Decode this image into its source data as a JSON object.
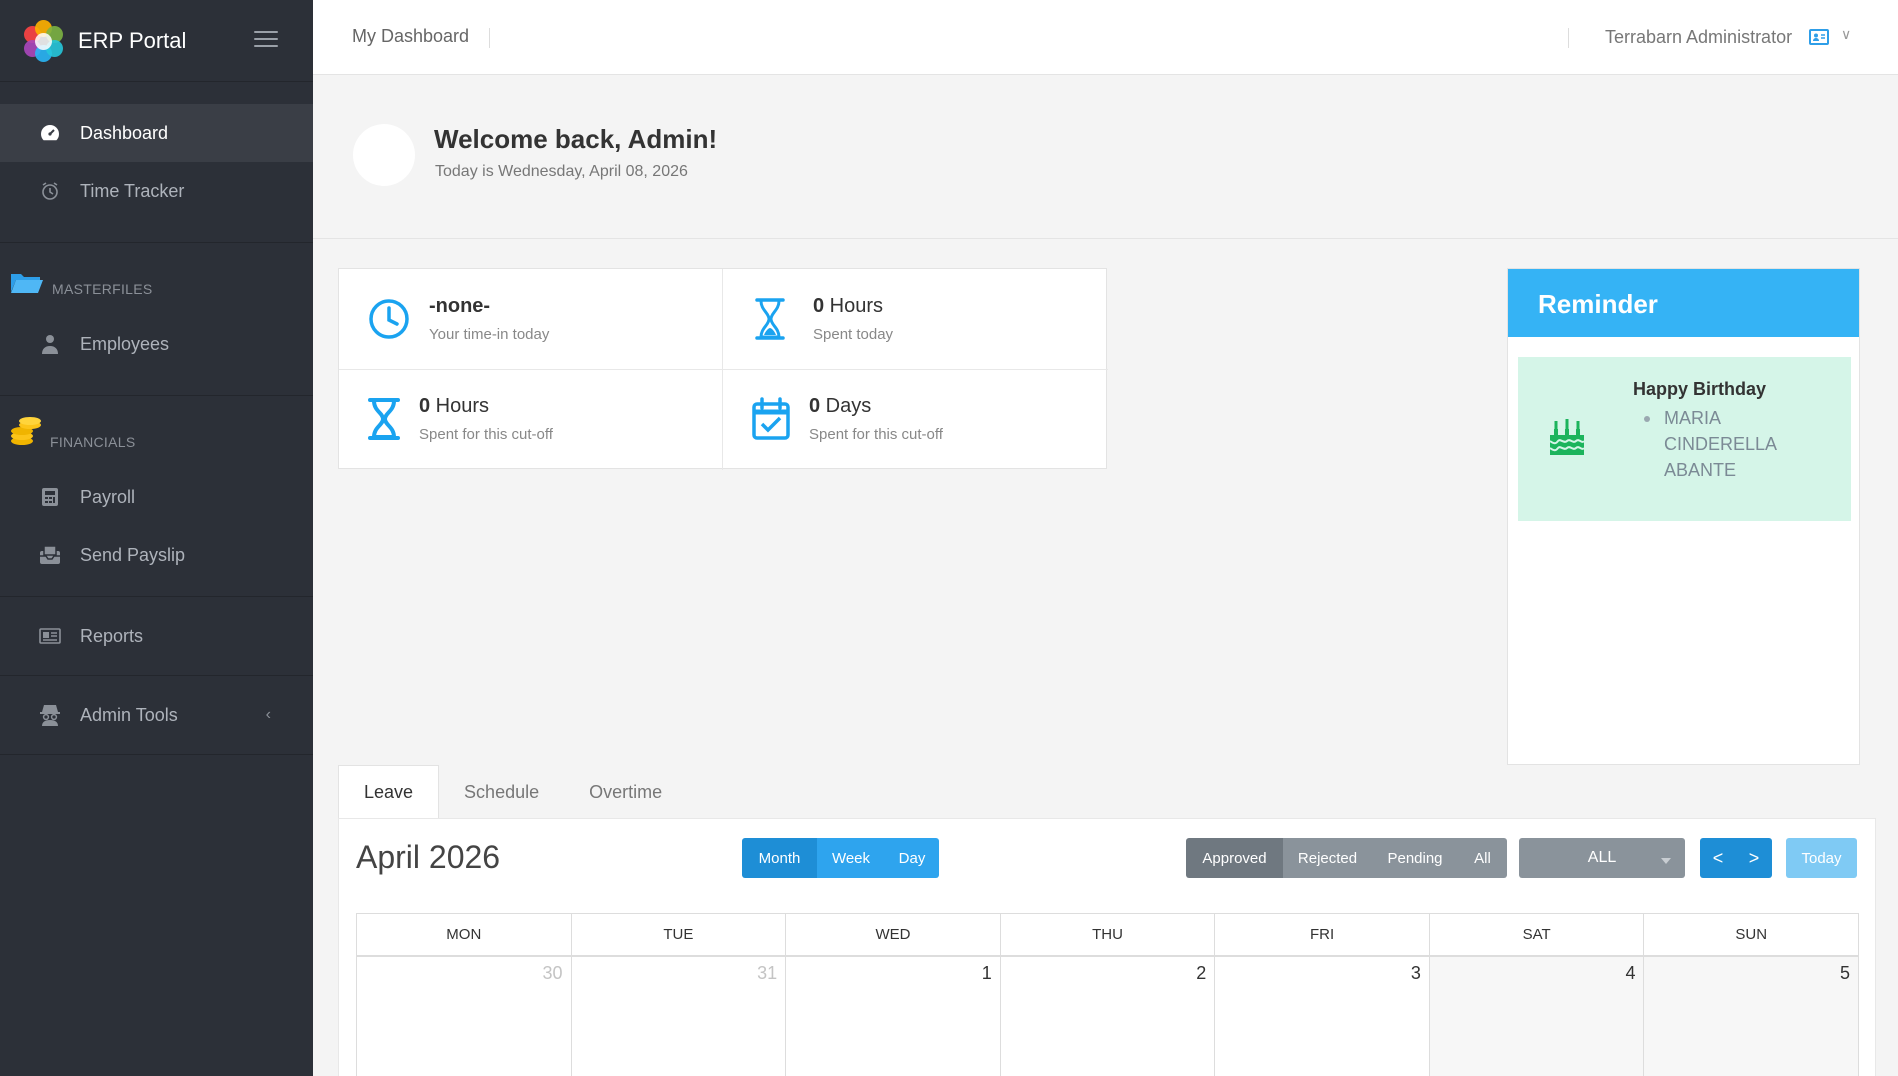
{
  "app": {
    "name": "ERP Portal"
  },
  "sidebar": {
    "items": [
      {
        "label": "Dashboard",
        "icon": "speedometer-icon"
      },
      {
        "label": "Time Tracker",
        "icon": "clock-icon"
      }
    ],
    "masterfiles": {
      "label": "MASTERFILES",
      "icon": "folder-icon",
      "items": [
        {
          "label": "Employees",
          "icon": "user-icon"
        }
      ]
    },
    "financials": {
      "label": "FINANCIALS",
      "icon": "coins-icon",
      "items": [
        {
          "label": "Payroll",
          "icon": "calculator-icon"
        },
        {
          "label": "Send Payslip",
          "icon": "inbox-icon"
        }
      ]
    },
    "reports": {
      "label": "Reports",
      "icon": "report-icon"
    },
    "admin_tools": {
      "label": "Admin Tools",
      "icon": "spy-icon"
    }
  },
  "topbar": {
    "breadcrumb": "My Dashboard",
    "user": "Terrabarn Administrator"
  },
  "welcome": {
    "title": "Welcome back, Admin!",
    "subtitle": "Today is Wednesday, April 08, 2026"
  },
  "stats": [
    {
      "value": "-none-",
      "unit": "",
      "label": "Your time-in today"
    },
    {
      "value": "0",
      "unit": " Hours",
      "label": "Spent today"
    },
    {
      "value": "0",
      "unit": " Hours",
      "label": "Spent for this cut-off"
    },
    {
      "value": "0",
      "unit": " Days",
      "label": "Spent for this cut-off"
    }
  ],
  "reminder": {
    "title": "Reminder",
    "birthday_title": "Happy Birthday",
    "names": [
      "MARIA CINDERELLA ABANTE"
    ]
  },
  "tabs": [
    "Leave",
    "Schedule",
    "Overtime"
  ],
  "calendar": {
    "title": "April 2026",
    "views": [
      "Month",
      "Week",
      "Day"
    ],
    "filters": [
      "Approved",
      "Rejected",
      "Pending",
      "All"
    ],
    "select_value": "ALL",
    "today_label": "Today",
    "prev_label": "<",
    "next_label": ">",
    "days": [
      "MON",
      "TUE",
      "WED",
      "THU",
      "FRI",
      "SAT",
      "SUN"
    ],
    "week1": [
      "30",
      "31",
      "1",
      "2",
      "3",
      "4",
      "5"
    ]
  },
  "colors": {
    "accent": "#35b3f5",
    "sidebar": "#2c3038",
    "birthday_bg": "#d5f5e8",
    "icon_blue": "#1aa3f0"
  }
}
